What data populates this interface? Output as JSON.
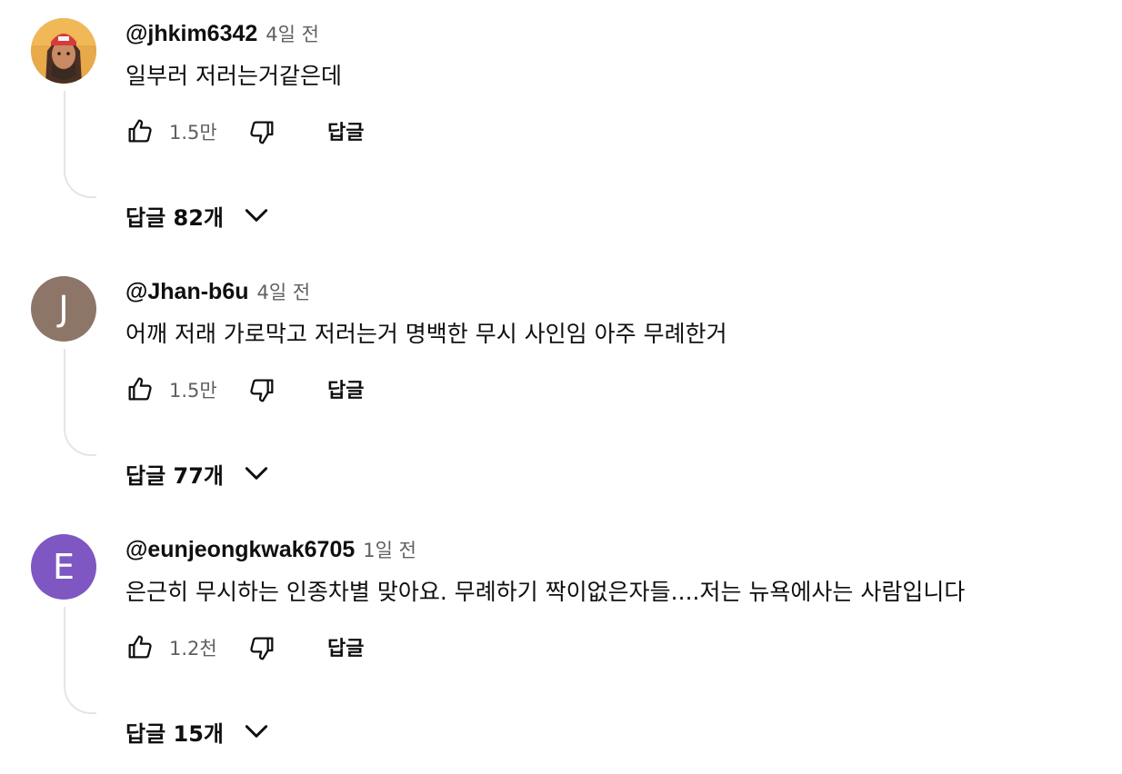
{
  "comments": [
    {
      "author": "@jhkim6342",
      "time": "4일 전",
      "text": "일부러 저러는거같은데",
      "likes": "1.5만",
      "reply_label": "답글",
      "replies_label": "답글 82개",
      "avatar": {
        "type": "image",
        "description_icon": "avatar-photo-icon",
        "bg": "#e8a94a"
      }
    },
    {
      "author": "@Jhan-b6u",
      "time": "4일 전",
      "text": "어깨 저래 가로막고 저러는거 명백한 무시 사인임 아주 무례한거",
      "likes": "1.5만",
      "reply_label": "답글",
      "replies_label": "답글 77개",
      "avatar": {
        "type": "letter",
        "letter": "J",
        "bg": "#8d7668"
      }
    },
    {
      "author": "@eunjeongkwak6705",
      "time": "1일 전",
      "text": "은근히 무시하는 인종차별 맞아요. 무례하기 짝이없은자들....저는 뉴욕에사는 사람입니다",
      "likes": "1.2천",
      "reply_label": "답글",
      "replies_label": "답글 15개",
      "avatar": {
        "type": "letter",
        "letter": "E",
        "bg": "#7e57c2"
      }
    }
  ],
  "icons": {
    "like": "thumbs-up-icon",
    "dislike": "thumbs-down-icon",
    "expand": "chevron-down-icon"
  },
  "colors": {
    "text_primary": "#0f0f0f",
    "text_secondary": "#606060",
    "thread_line": "#e5e5e5"
  }
}
